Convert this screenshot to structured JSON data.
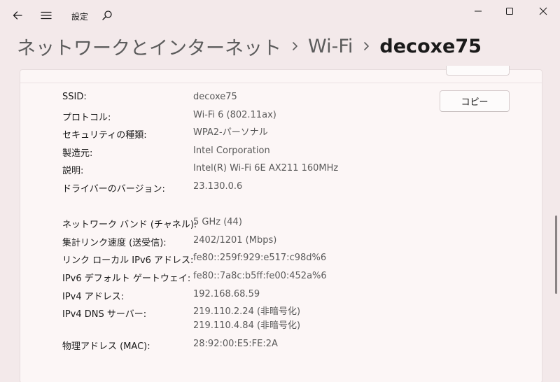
{
  "window": {
    "app_title": "設定"
  },
  "breadcrumb": {
    "items": [
      "ネットワークとインターネット",
      "Wi-Fi",
      "decoxe75"
    ]
  },
  "card": {
    "copy_label": "コピー",
    "properties": [
      {
        "label": "SSID:",
        "value": "decoxe75"
      },
      {
        "label": "プロトコル:",
        "value": "Wi-Fi 6 (802.11ax)"
      },
      {
        "label": "セキュリティの種類:",
        "value": "WPA2-パーソナル"
      },
      {
        "label": "製造元:",
        "value": "Intel Corporation"
      },
      {
        "label": "説明:",
        "value": "Intel(R) Wi-Fi 6E AX211 160MHz"
      },
      {
        "label": "ドライバーのバージョン:",
        "value": "23.130.0.6"
      },
      {
        "label": "ネットワーク バンド (チャネル):",
        "value": "5 GHz (44)"
      },
      {
        "label": "集計リンク速度 (送受信):",
        "value": "2402/1201 (Mbps)"
      },
      {
        "label": "リンク ローカル IPv6 アドレス:",
        "value": "fe80::259f:929:e517:c98d%6"
      },
      {
        "label": "IPv6 デフォルト ゲートウェイ:",
        "value": "fe80::7a8c:b5ff:fe00:452a%6"
      },
      {
        "label": "IPv4 アドレス:",
        "value": "192.168.68.59"
      },
      {
        "label": "IPv4 DNS サーバー:",
        "value": "219.110.2.24 (非暗号化)",
        "value2": "219.110.4.84 (非暗号化)"
      },
      {
        "label": "物理アドレス (MAC):",
        "value": "28:92:00:E5:FE:2A"
      }
    ]
  }
}
